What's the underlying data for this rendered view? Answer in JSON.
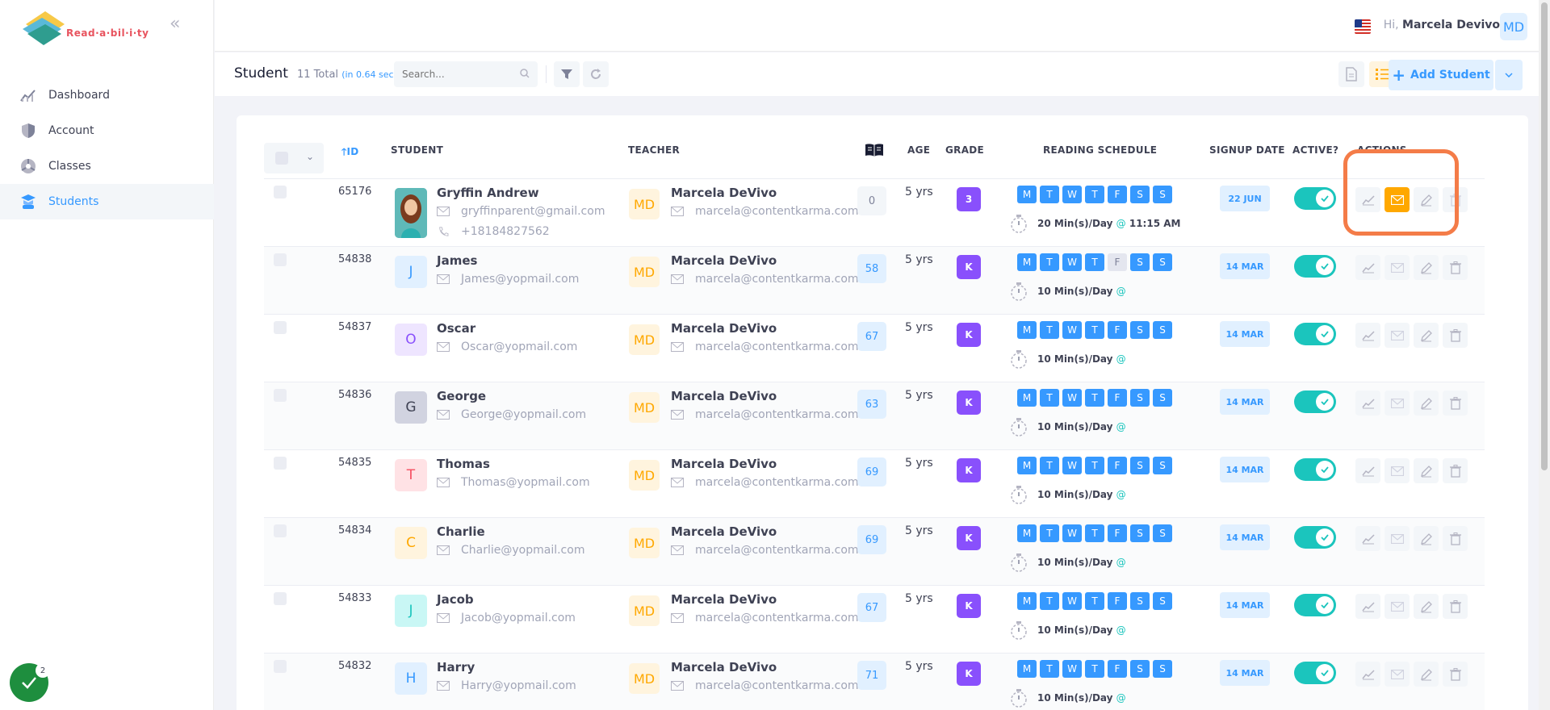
{
  "app": {
    "logo_text": "Read·a·bil·i·ty",
    "greeting": "Hi,",
    "user_name": "Marcela Devivo",
    "user_initials": "MD"
  },
  "sidebar": {
    "items": [
      {
        "label": "Dashboard",
        "icon": "chart-icon"
      },
      {
        "label": "Account",
        "icon": "shield-icon"
      },
      {
        "label": "Classes",
        "icon": "classes-icon"
      },
      {
        "label": "Students",
        "icon": "graduate-icon",
        "active": true
      }
    ]
  },
  "subheader": {
    "title": "Student",
    "total": "11 Total",
    "timing": "(in 0.64 sec)",
    "search_placeholder": "Search...",
    "add_label": "Add Student"
  },
  "table": {
    "headers": {
      "id": "ID",
      "student": "STUDENT",
      "teacher": "TEACHER",
      "age": "AGE",
      "grade": "GRADE",
      "schedule": "READING SCHEDULE",
      "signup": "SIGNUP DATE",
      "active": "ACTIVE?",
      "actions": "ACTIONS"
    },
    "day_letters": [
      "M",
      "T",
      "W",
      "T",
      "F",
      "S",
      "S"
    ],
    "rows": [
      {
        "id": "65176",
        "name": "Gryffin Andrew",
        "email": "gryffinparent@gmail.com",
        "phone": "+18184827562",
        "initial": "",
        "teacher": "Marcela DeVivo",
        "teacher_initials": "MD",
        "teacher_email": "marcela@contentkarma.com",
        "books": "0",
        "age": "5 yrs",
        "grade": "3",
        "schedule": "20 Min(s)/Day",
        "at": "@",
        "time": "11:15 AM",
        "signup": "22 JUN"
      },
      {
        "id": "54838",
        "name": "James",
        "email": "James@yopmail.com",
        "initial": "J",
        "teacher": "Marcela DeVivo",
        "teacher_initials": "MD",
        "teacher_email": "marcela@contentkarma.com",
        "books": "58",
        "age": "5 yrs",
        "grade": "K",
        "schedule": "10 Min(s)/Day",
        "at": "@",
        "time": "",
        "signup": "14 MAR"
      },
      {
        "id": "54837",
        "name": "Oscar",
        "email": "Oscar@yopmail.com",
        "initial": "O",
        "teacher": "Marcela DeVivo",
        "teacher_initials": "MD",
        "teacher_email": "marcela@contentkarma.com",
        "books": "67",
        "age": "5 yrs",
        "grade": "K",
        "schedule": "10 Min(s)/Day",
        "at": "@",
        "time": "",
        "signup": "14 MAR"
      },
      {
        "id": "54836",
        "name": "George",
        "email": "George@yopmail.com",
        "initial": "G",
        "teacher": "Marcela DeVivo",
        "teacher_initials": "MD",
        "teacher_email": "marcela@contentkarma.com",
        "books": "63",
        "age": "5 yrs",
        "grade": "K",
        "schedule": "10 Min(s)/Day",
        "at": "@",
        "time": "",
        "signup": "14 MAR"
      },
      {
        "id": "54835",
        "name": "Thomas",
        "email": "Thomas@yopmail.com",
        "initial": "T",
        "teacher": "Marcela DeVivo",
        "teacher_initials": "MD",
        "teacher_email": "marcela@contentkarma.com",
        "books": "69",
        "age": "5 yrs",
        "grade": "K",
        "schedule": "10 Min(s)/Day",
        "at": "@",
        "time": "",
        "signup": "14 MAR"
      },
      {
        "id": "54834",
        "name": "Charlie",
        "email": "Charlie@yopmail.com",
        "initial": "C",
        "teacher": "Marcela DeVivo",
        "teacher_initials": "MD",
        "teacher_email": "marcela@contentkarma.com",
        "books": "69",
        "age": "5 yrs",
        "grade": "K",
        "schedule": "10 Min(s)/Day",
        "at": "@",
        "time": "",
        "signup": "14 MAR"
      },
      {
        "id": "54833",
        "name": "Jacob",
        "email": "Jacob@yopmail.com",
        "initial": "J",
        "teacher": "Marcela DeVivo",
        "teacher_initials": "MD",
        "teacher_email": "marcela@contentkarma.com",
        "books": "67",
        "age": "5 yrs",
        "grade": "K",
        "schedule": "10 Min(s)/Day",
        "at": "@",
        "time": "",
        "signup": "14 MAR"
      },
      {
        "id": "54832",
        "name": "Harry",
        "email": "Harry@yopmail.com",
        "initial": "H",
        "teacher": "Marcela DeVivo",
        "teacher_initials": "MD",
        "teacher_email": "marcela@contentkarma.com",
        "books": "71",
        "age": "5 yrs",
        "grade": "K",
        "schedule": "10 Min(s)/Day",
        "at": "@",
        "time": "",
        "signup": "14 MAR"
      }
    ]
  },
  "fab": {
    "badge": "2"
  },
  "colors": {
    "primary": "#3699ff",
    "success": "#1bc5bd",
    "warning": "#ffa800",
    "grade": "#8950fc",
    "highlight": "#f47c48"
  }
}
